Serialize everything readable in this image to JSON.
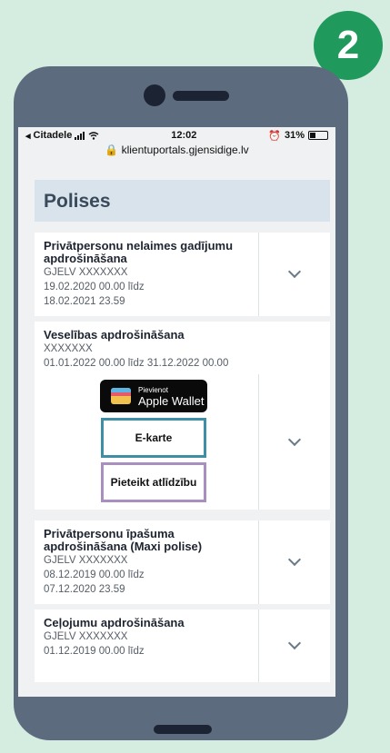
{
  "step_badge": "2",
  "status": {
    "carrier": "Citadele",
    "time": "12:02",
    "battery": "31%"
  },
  "browser": {
    "url": "klientuportals.gjensidige.lv"
  },
  "page": {
    "title": "Polises"
  },
  "policies": [
    {
      "title": "Privātpersonu nelaimes gadījumu apdrošināšana",
      "number": "GJELV XXXXXXX",
      "from": "19.02.2020 00.00 līdz",
      "to": "18.02.2021 23.59"
    },
    {
      "title": "Veselības apdrošināšana",
      "number": "XXXXXXX",
      "period": "01.01.2022 00.00 līdz 31.12.2022 00.00",
      "wallet_small": "Pievienot",
      "wallet_big": "Apple Wallet",
      "ecard": "E-karte",
      "claim": "Pieteikt atlīdzību"
    },
    {
      "title": "Privātpersonu īpašuma apdrošināšana (Maxi polise)",
      "number": "GJELV XXXXXXX",
      "from": "08.12.2019 00.00 līdz",
      "to": "07.12.2020 23.59"
    },
    {
      "title": "Ceļojumu apdrošināšana",
      "number": "GJELV XXXXXXX",
      "from": "01.12.2019 00.00 līdz"
    }
  ],
  "colors": {
    "background": "#d5ece0",
    "badge": "#1f9a5c",
    "phone": "#5d6b7f",
    "ecard_border": "#3e8ea6",
    "claim_border": "#a98ec0"
  }
}
